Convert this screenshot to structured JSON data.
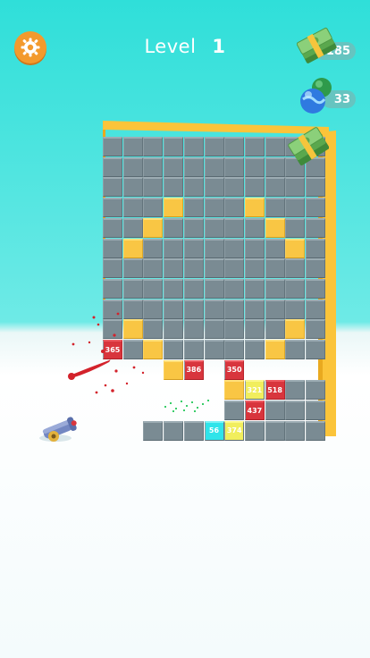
{
  "hud": {
    "settings_icon": "gear-icon",
    "level_label": "Level",
    "level_number": "1",
    "cash_count": "185",
    "gem_count": "33"
  },
  "board": {
    "reward_icon": "cash-stack-icon",
    "blocks": [
      {
        "text": "365"
      },
      {
        "text": "386"
      },
      {
        "text": "350"
      },
      {
        "text": "518"
      },
      {
        "text": "437"
      },
      {
        "text": "56"
      },
      {
        "text": "374"
      },
      {
        "text": "321"
      }
    ]
  },
  "player": {
    "cannon_icon": "cannon-icon"
  },
  "colors": {
    "sky": "#2fdfd9",
    "wall_gray": "#7a8b93",
    "target_yellow": "#f9c644",
    "block_red": "#d8353d",
    "frame_orange": "#fbc43a"
  }
}
